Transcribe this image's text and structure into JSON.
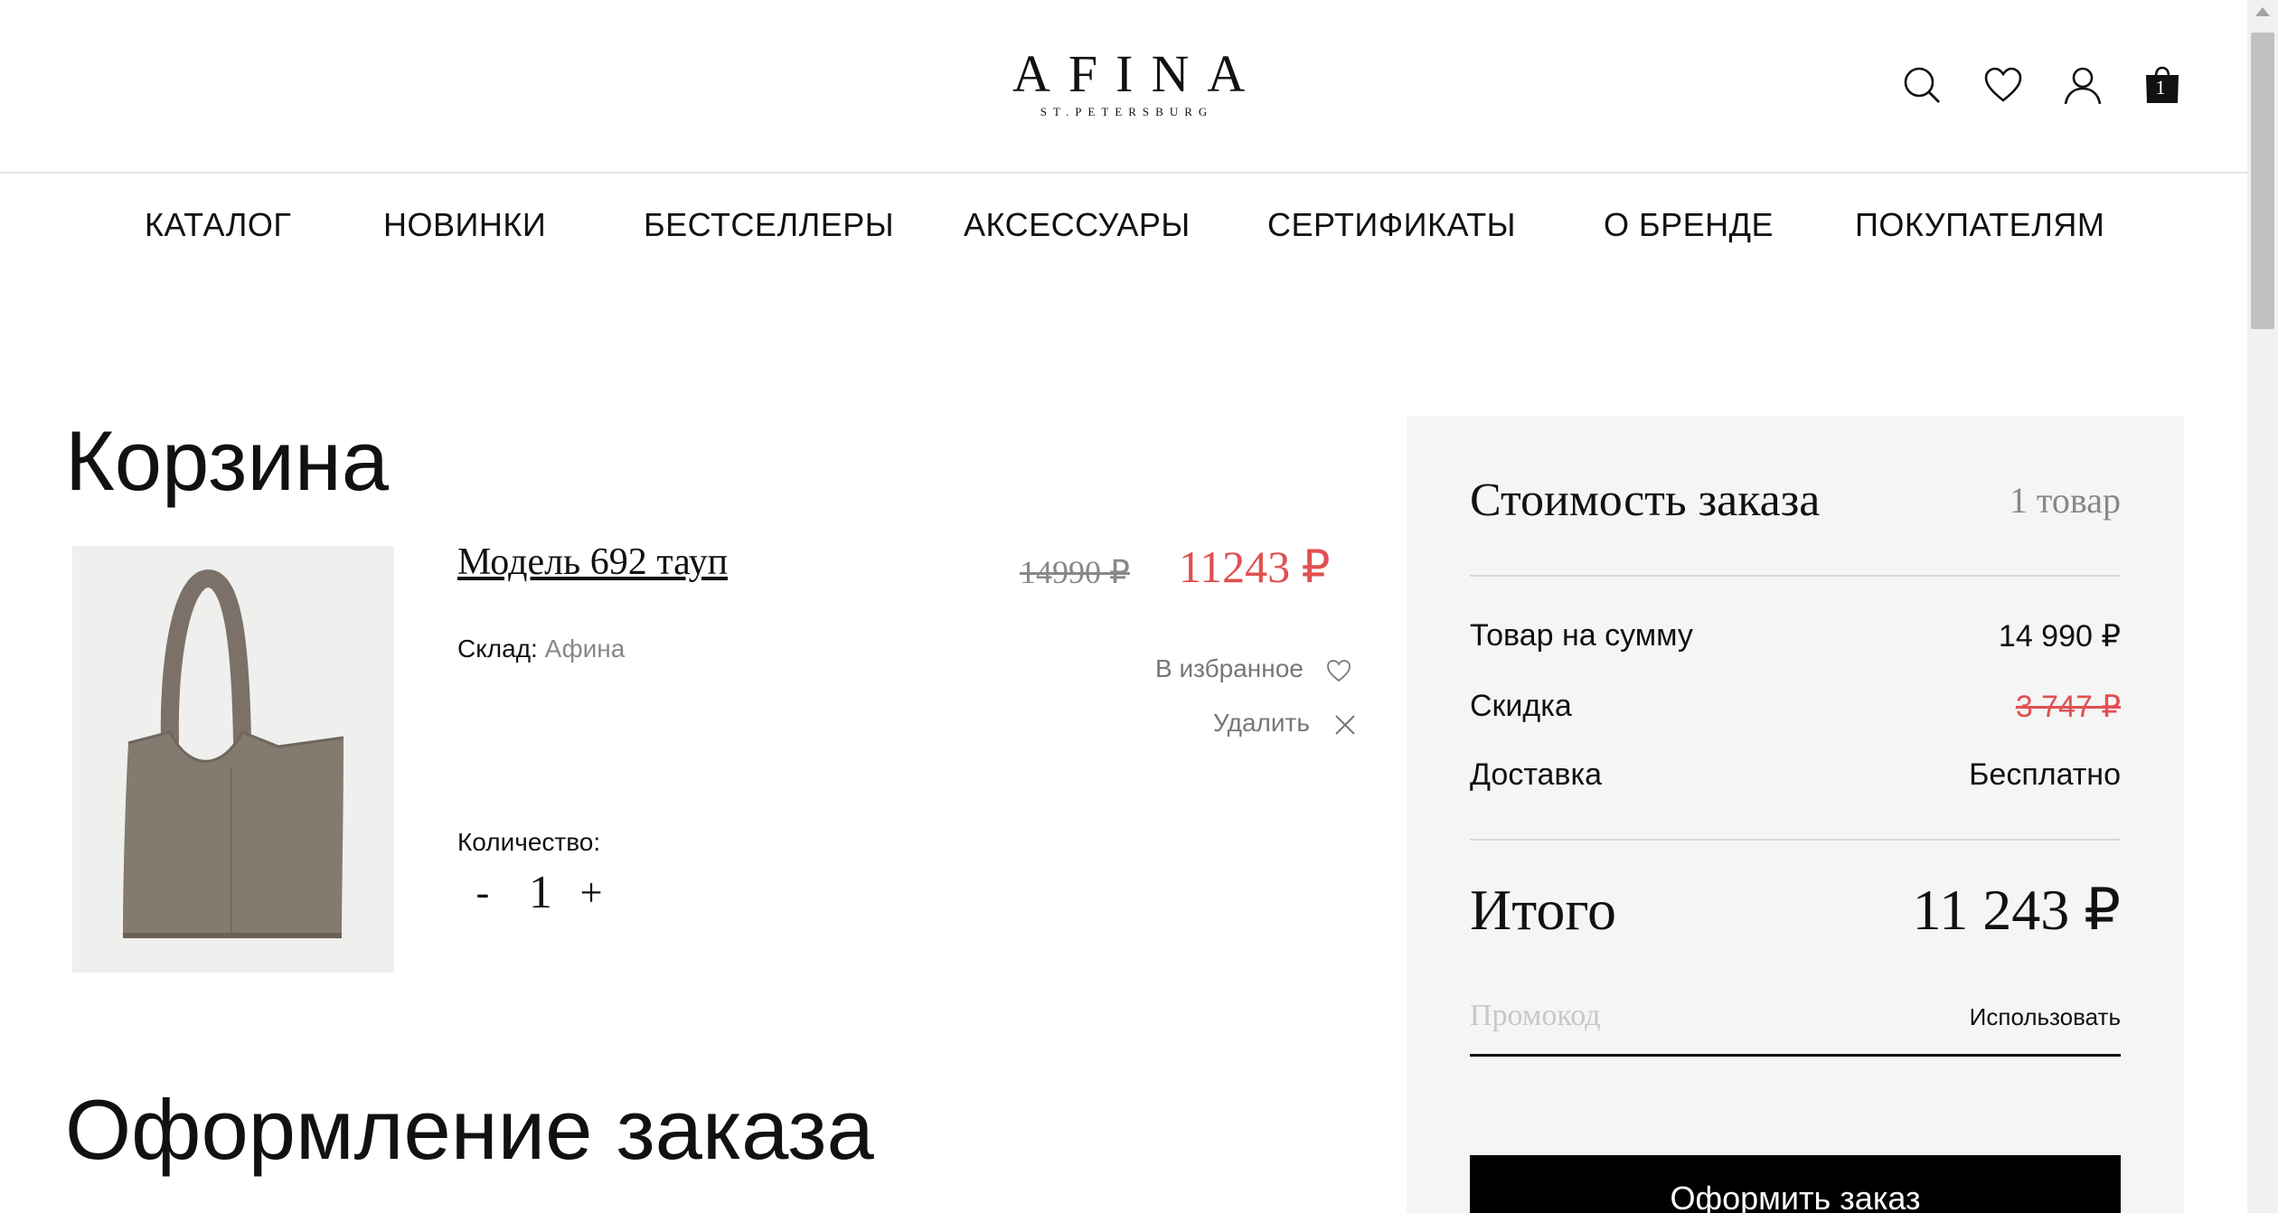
{
  "header": {
    "logo_main": "AFINA",
    "logo_sub": "ST.PETERSBURG",
    "cart_count": "1",
    "icons": [
      "search-icon",
      "heart-icon",
      "user-icon",
      "shopping-bag-icon"
    ]
  },
  "nav": {
    "items": [
      "КАТАЛОГ",
      "НОВИНКИ",
      "БЕСТСЕЛЛЕРЫ",
      "АКСЕССУАРЫ",
      "СЕРТИФИКАТЫ",
      "О БРЕНДЕ",
      "ПОКУПАТЕЛЯМ"
    ]
  },
  "cart": {
    "title": "Корзина",
    "item": {
      "name": "Модель 692 тауп",
      "old_price": "14990 ₽",
      "price": "11243 ₽",
      "stock_label": "Склад:",
      "stock_value": "Афина",
      "favorite_label": "В избранное",
      "delete_label": "Удалить",
      "quantity_label": "Количество:",
      "quantity_minus": "-",
      "quantity_plus": "+",
      "quantity": "1",
      "image_color": "#837a70"
    }
  },
  "checkout": {
    "title": "Оформление заказа"
  },
  "summary": {
    "title": "Стоимость заказа",
    "count": "1 товар",
    "rows": [
      {
        "label": "Товар на сумму",
        "value": "14 990 ₽"
      },
      {
        "label": "Скидка",
        "value": "3 747 ₽"
      },
      {
        "label": "Доставка",
        "value": "Бесплатно"
      }
    ],
    "total_label": "Итого",
    "total_value": "11 243 ₽",
    "promo_placeholder": "Промокод",
    "promo_apply": "Использовать",
    "checkout_button": "Оформить заказ"
  },
  "colors": {
    "accent_red": "#e05052",
    "panel_bg": "#f5f5f5",
    "button_bg": "#000000"
  }
}
